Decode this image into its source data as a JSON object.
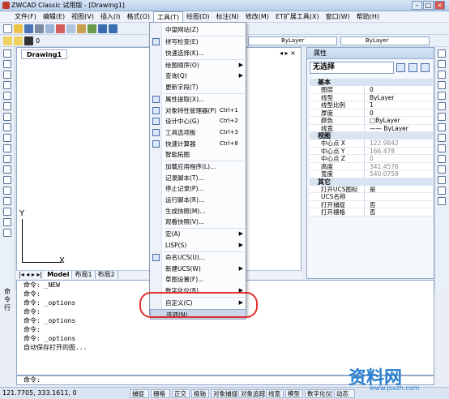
{
  "window": {
    "title": "ZWCAD Classic 试用版 - [Drawing1]"
  },
  "menubar": [
    "文件(F)",
    "编辑(E)",
    "视图(V)",
    "插入(I)",
    "格式(O)",
    "工具(T)",
    "绘图(D)",
    "标注(N)",
    "修改(M)",
    "ET扩展工具(X)",
    "窗口(W)",
    "帮助(H)"
  ],
  "toolbar": {
    "layer_value": "0",
    "linetype1": "ByLayer",
    "linetype2": "ByLayer"
  },
  "drawing": {
    "tab": "Drawing1",
    "x_axis": "X",
    "y_axis": "Y",
    "layout_tabs": [
      "Model",
      "布局1",
      "布局2"
    ]
  },
  "tools_menu": {
    "items": [
      {
        "label": "中望网站(Z)",
        "shortcut": "",
        "arrow": ""
      },
      {
        "label": "拼写检查(E)",
        "shortcut": "",
        "arrow": ""
      },
      {
        "label": "快速选择(K)...",
        "shortcut": "",
        "arrow": ""
      },
      {
        "label": "绘图顺序(O)",
        "shortcut": "",
        "arrow": "▶"
      },
      {
        "label": "查询(Q)",
        "shortcut": "",
        "arrow": "▶"
      },
      {
        "label": "更新字段(T)",
        "shortcut": "",
        "arrow": ""
      },
      {
        "label": "属性提取(X)...",
        "shortcut": "",
        "arrow": ""
      },
      {
        "label": "对象特性管理器(P)",
        "shortcut": "Ctrl+1",
        "arrow": ""
      },
      {
        "label": "设计中心(G)",
        "shortcut": "Ctrl+2",
        "arrow": ""
      },
      {
        "label": "工具选项板",
        "shortcut": "Ctrl+3",
        "arrow": ""
      },
      {
        "label": "快速计算器",
        "shortcut": "Ctrl+8",
        "arrow": ""
      },
      {
        "label": "智能拓图",
        "shortcut": "",
        "arrow": ""
      },
      {
        "label": "加载应用程序(L)...",
        "shortcut": "",
        "arrow": ""
      },
      {
        "label": "记录脚本(T)...",
        "shortcut": "",
        "arrow": ""
      },
      {
        "label": "停止记录(P)...",
        "shortcut": "",
        "arrow": ""
      },
      {
        "label": "运行脚本(R)...",
        "shortcut": "",
        "arrow": ""
      },
      {
        "label": "生成快照(M)...",
        "shortcut": "",
        "arrow": ""
      },
      {
        "label": "观看快照(V)...",
        "shortcut": "",
        "arrow": ""
      },
      {
        "label": "宏(A)",
        "shortcut": "",
        "arrow": "▶"
      },
      {
        "label": "LISP(S)",
        "shortcut": "",
        "arrow": "▶"
      },
      {
        "label": "命名UCS(U)...",
        "shortcut": "",
        "arrow": ""
      },
      {
        "label": "新建UCS(W)",
        "shortcut": "",
        "arrow": "▶"
      },
      {
        "label": "草图设置(F)...",
        "shortcut": "",
        "arrow": ""
      },
      {
        "label": "数字化仪(B)",
        "shortcut": "",
        "arrow": "▶"
      },
      {
        "label": "自定义(C)",
        "shortcut": "",
        "arrow": "▶"
      },
      {
        "label": "选项(N)...",
        "shortcut": "",
        "arrow": ""
      }
    ]
  },
  "properties": {
    "title": "属性",
    "selection": "无选择",
    "sections": [
      {
        "name": "基本",
        "rows": [
          {
            "k": "图层",
            "v": "0",
            "gray": false
          },
          {
            "k": "线型",
            "v": "ByLayer",
            "gray": false
          },
          {
            "k": "线型比例",
            "v": "1",
            "gray": false
          },
          {
            "k": "厚度",
            "v": "0",
            "gray": false
          },
          {
            "k": "颜色",
            "v": "□ByLayer",
            "gray": false
          },
          {
            "k": "线宽",
            "v": "—— ByLayer",
            "gray": false
          }
        ]
      },
      {
        "name": "视图",
        "rows": [
          {
            "k": "中心点 X",
            "v": "122.9842",
            "gray": true
          },
          {
            "k": "中心点 Y",
            "v": "166.478",
            "gray": true
          },
          {
            "k": "中心点 Z",
            "v": "0",
            "gray": true
          },
          {
            "k": "高度",
            "v": "341.4576",
            "gray": true
          },
          {
            "k": "宽度",
            "v": "540.0759",
            "gray": true
          }
        ]
      },
      {
        "name": "其它",
        "rows": [
          {
            "k": "打开UCS图标",
            "v": "是",
            "gray": false
          },
          {
            "k": "UCS名称",
            "v": "",
            "gray": false
          },
          {
            "k": "打开捕捉",
            "v": "否",
            "gray": false
          },
          {
            "k": "打开栅格",
            "v": "否",
            "gray": false
          }
        ]
      }
    ]
  },
  "command": {
    "label": "命令行",
    "lines": [
      "命令: _NEW",
      "命令:",
      "命令: _options",
      "命令:",
      "命令: _options",
      "命令:",
      "命令: _options",
      "自动保存打开的图..."
    ],
    "prompt": "命令:"
  },
  "status": {
    "coords": "121.7705,  333.1611,  0",
    "buttons": [
      "捕捉",
      "栅格",
      "正交",
      "极轴",
      "对象捕捉",
      "对象追踪",
      "线宽",
      "模型",
      "数字化仪",
      "动态"
    ]
  },
  "watermark": {
    "text": "资料网",
    "sub": "www.jsxzh.com"
  }
}
